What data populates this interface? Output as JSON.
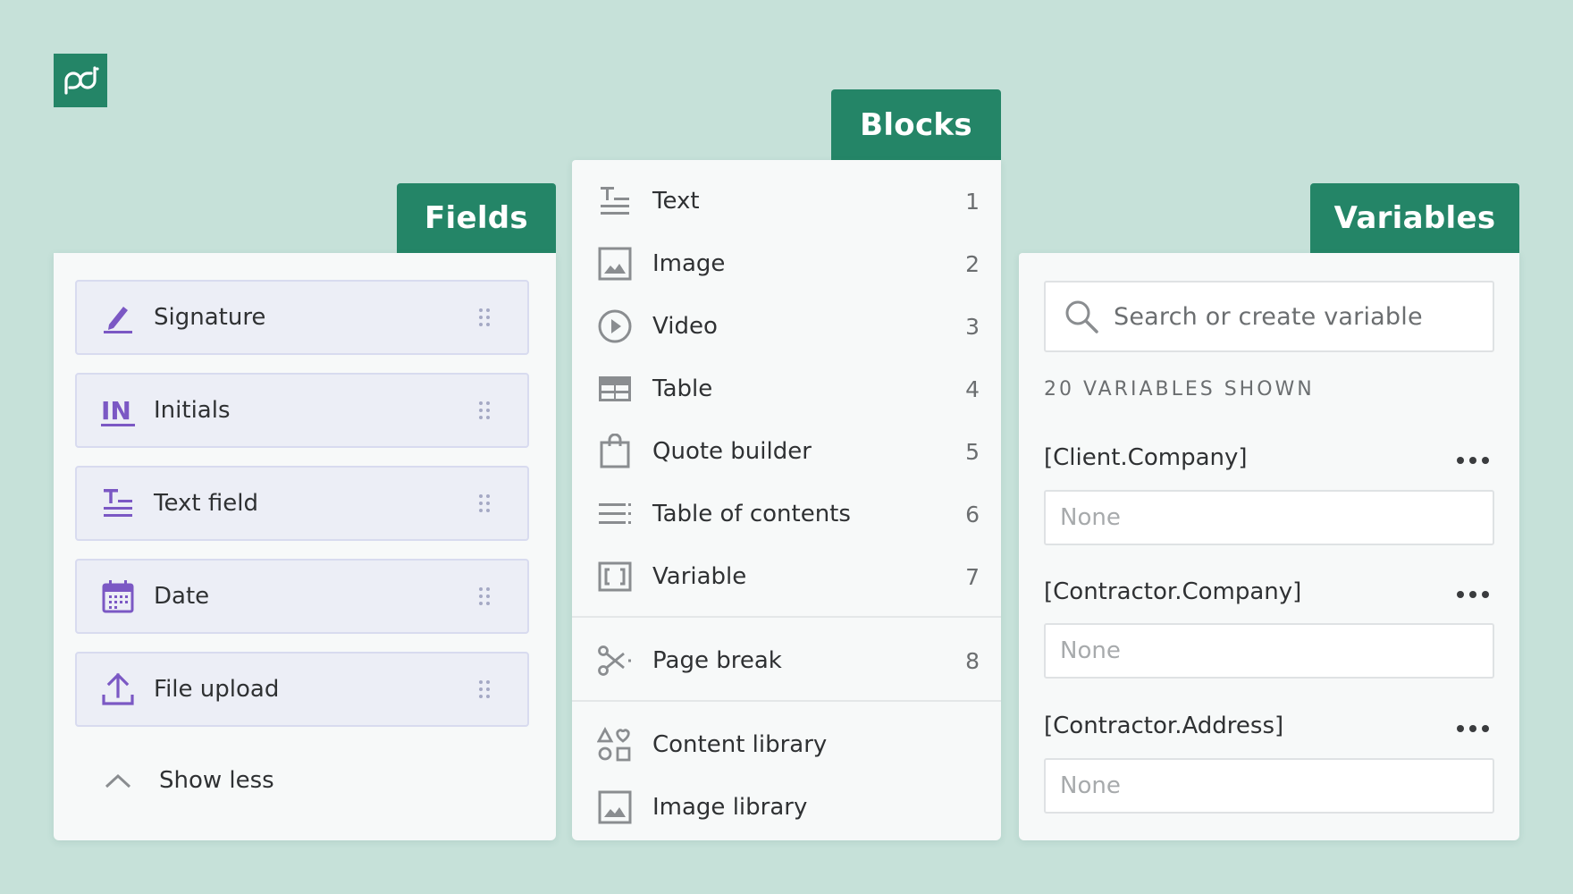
{
  "brand": {
    "logo_icon": "pandadoc-logo-icon",
    "color": "#248567"
  },
  "fields": {
    "tab_label": "Fields",
    "items": [
      {
        "label": "Signature",
        "icon": "signature-pen-icon"
      },
      {
        "label": "Initials",
        "icon": "initials-icon"
      },
      {
        "label": "Text field",
        "icon": "text-field-icon"
      },
      {
        "label": "Date",
        "icon": "calendar-icon"
      },
      {
        "label": "File upload",
        "icon": "upload-icon"
      }
    ],
    "show_less": "Show less",
    "accent_color": "#7b58c4"
  },
  "blocks": {
    "tab_label": "Blocks",
    "items": [
      {
        "label": "Text",
        "shortcut": "1",
        "icon": "text-icon"
      },
      {
        "label": "Image",
        "shortcut": "2",
        "icon": "image-icon"
      },
      {
        "label": "Video",
        "shortcut": "3",
        "icon": "video-play-icon"
      },
      {
        "label": "Table",
        "shortcut": "4",
        "icon": "table-icon"
      },
      {
        "label": "Quote builder",
        "shortcut": "5",
        "icon": "shopping-bag-icon"
      },
      {
        "label": "Table of contents",
        "shortcut": "6",
        "icon": "table-of-contents-icon"
      },
      {
        "label": "Variable",
        "shortcut": "7",
        "icon": "variable-brackets-icon"
      },
      {
        "label": "Page break",
        "shortcut": "8",
        "icon": "scissors-icon"
      },
      {
        "label": "Content library",
        "icon": "shapes-icon"
      },
      {
        "label": "Image library",
        "icon": "image-library-icon"
      }
    ]
  },
  "variables": {
    "tab_label": "Variables",
    "search_placeholder": "Search or create variable",
    "count_label": "20 VARIABLES SHOWN",
    "items": [
      {
        "name": "[Client.Company]",
        "value": "None"
      },
      {
        "name": "[Contractor.Company]",
        "value": "None"
      },
      {
        "name": "[Contractor.Address]",
        "value": "None"
      }
    ]
  }
}
